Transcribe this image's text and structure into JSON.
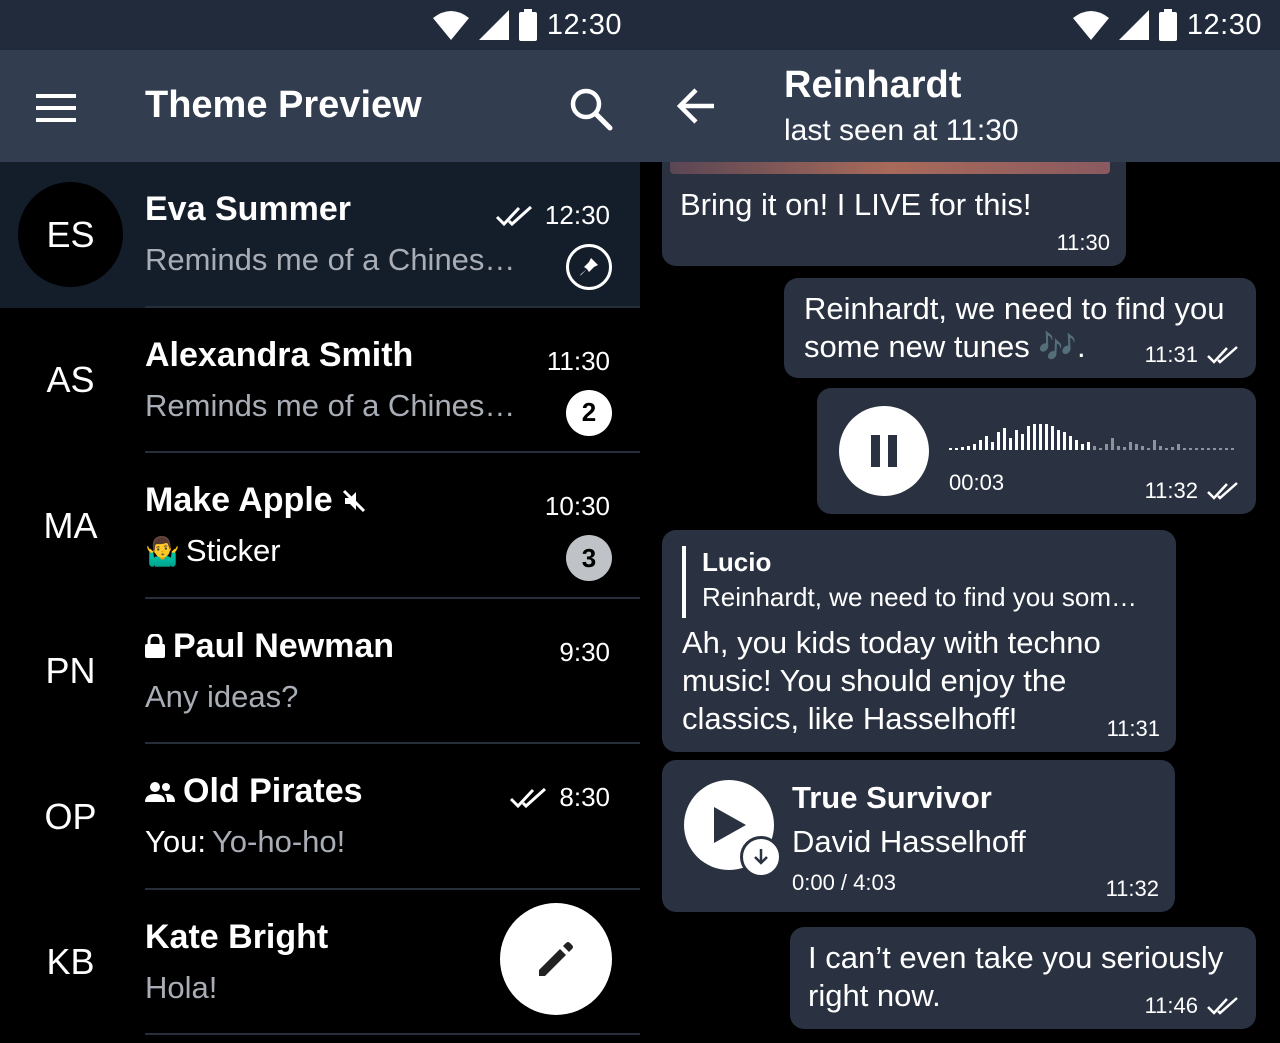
{
  "status_bar": {
    "time": "12:30"
  },
  "chat_list": {
    "title": "Theme Preview",
    "chats": [
      {
        "initials": "ES",
        "name": "Eva Summer",
        "preview": "Reminds me of a Chines…",
        "time": "12:30"
      },
      {
        "initials": "AS",
        "name": "Alexandra Smith",
        "preview": "Reminds me of a Chines…",
        "time": "11:30",
        "unread": "2"
      },
      {
        "initials": "MA",
        "name": "Make Apple",
        "preview_emoji": "🤷‍♂️",
        "preview": "Sticker",
        "time": "10:30",
        "unread": "3"
      },
      {
        "initials": "PN",
        "name": "Paul Newman",
        "preview": "Any ideas?",
        "time": "9:30"
      },
      {
        "initials": "OP",
        "name": "Old Pirates",
        "preview_sender": "You:",
        "preview": "Yo-ho-ho!",
        "time": "8:30"
      },
      {
        "initials": "KB",
        "name": "Kate Bright",
        "preview": "Hola!"
      }
    ]
  },
  "conversation": {
    "name": "Reinhardt",
    "status": "last seen at 11:30",
    "messages": [
      {
        "text": "Bring it on! I LIVE for this!",
        "time": "11:30"
      },
      {
        "text_line1": "Reinhardt, we need to find you",
        "text_line2": "some new tunes 🎶.",
        "time": "11:31"
      },
      {
        "voice_duration": "00:03",
        "time": "11:32",
        "voice_progress": 0.0
      },
      {
        "reply_author": "Lucio",
        "reply_text": "Reinhardt, we need to find you som…",
        "text_line1": "Ah, you kids today with techno",
        "text_line2": "music! You should enjoy the",
        "text_line3": "classics, like Hasselhoff!",
        "time": "11:31"
      },
      {
        "track_title": "True Survivor",
        "track_artist": "David Hasselhoff",
        "track_progress": "0:00 / 4:03",
        "time": "11:32"
      },
      {
        "text_line1": "I can’t even take you seriously",
        "text_line2": "right now.",
        "time": "11:46"
      }
    ]
  },
  "colors": {
    "statusbar": "#212b3c",
    "appbar": "#323e50",
    "background": "#000000",
    "bubble": "#2a3140",
    "active_row": "#141d2a",
    "secondary_text": "#a9aeb6"
  }
}
